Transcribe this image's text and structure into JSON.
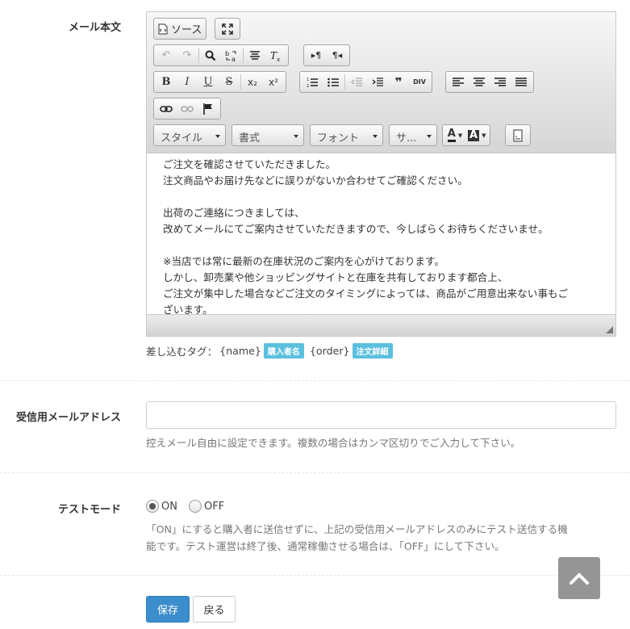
{
  "labels": {
    "mail_body": "メール本文",
    "receive_email": "受信用メールアドレス",
    "test_mode": "テストモード"
  },
  "editor": {
    "toolbar": {
      "source_label": "ソース",
      "combos": {
        "style": "スタイル",
        "format": "書式",
        "font": "フォント",
        "size": "サ..."
      },
      "buttons": {
        "bold": "B",
        "italic": "I",
        "underline": "U",
        "strike": "S",
        "subscript": "x₂",
        "superscript": "x²",
        "blockquote": "❞",
        "div": "DIV",
        "ltr": "▸¶",
        "rtl": "¶◂",
        "text_color": "A",
        "bg_color": "A"
      }
    },
    "content_lines": [
      "ご注文を確認させていただきました。",
      "注文商品やお届け先などに誤りがないか合わせてご確認ください。",
      "",
      "出荷のご連絡につきましては、",
      "改めてメールにてご案内させていただきますので、今しばらくお待ちくださいませ。",
      "",
      "※当店では常に最新の在庫状況のご案内を心がけております。",
      "しかし、卸売業や他ショッピングサイトと在庫を共有しております都合上、",
      "ご注文が集中した場合などご注文のタイミングによっては、商品がご用意出来ない事もご",
      "ざいます。"
    ]
  },
  "tags": {
    "prefix": "差し込むタグ：",
    "name_token": "{name}",
    "name_badge": "購入者名",
    "order_token": "{order}",
    "order_badge": "注文詳細"
  },
  "receive_email": {
    "value": "",
    "help": "控えメール自由に設定できます。複数の場合はカンマ区切りでご入力して下さい。"
  },
  "test_mode": {
    "on_label": "ON",
    "off_label": "OFF",
    "selected": "ON",
    "help_line1": "「ON」にすると購入者に送信せずに、上記の受信用メールアドレスのみにテスト送信する機",
    "help_line2": "能です。テスト運営は終了後、通常稼働させる場合は、「OFF」にして下さい。"
  },
  "actions": {
    "save": "保存",
    "back": "戻る"
  },
  "colors": {
    "primary": "#3c8dcb",
    "badge": "#5bc0de"
  }
}
